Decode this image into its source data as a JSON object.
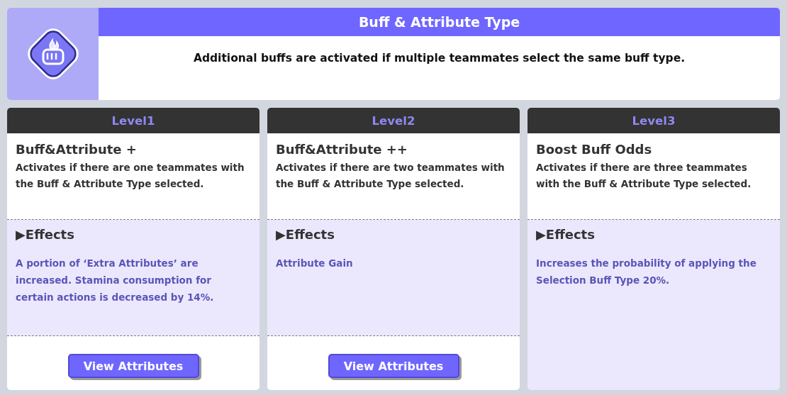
{
  "header": {
    "title": "Buff & Attribute Type",
    "description": "Additional buffs are activated if multiple teammates select the same buff type."
  },
  "levels": [
    {
      "label": "Level1",
      "name": "Buff&Attribute +",
      "condition": "Activates if there are one teammates with the Buff & Attribute Type selected.",
      "effects_heading": "▶Effects",
      "effect": "A portion of ‘Extra Attributes’ are increased. Stamina consumption for certain actions is decreased by 14%.",
      "button": "View Attributes"
    },
    {
      "label": "Level2",
      "name": "Buff&Attribute ++",
      "condition": "Activates if there are two teammates with the Buff & Attribute Type selected.",
      "effects_heading": "▶Effects",
      "effect": "Attribute Gain",
      "button": "View Attributes"
    },
    {
      "label": "Level3",
      "name": "Boost Buff Odds",
      "condition": "Activates if there are three teammates with the Buff & Attribute Type selected.",
      "effects_heading": "▶Effects",
      "effect": "Increases the probability of applying the Selection Buff Type 20%."
    }
  ]
}
